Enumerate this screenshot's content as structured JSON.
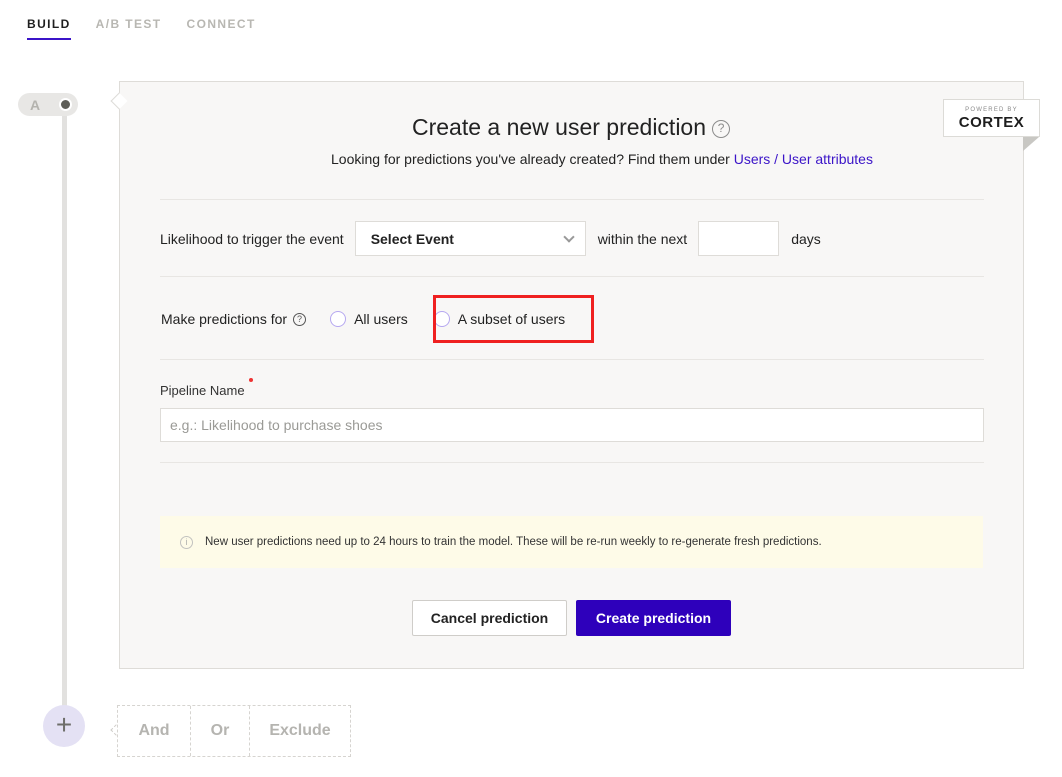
{
  "tabs": [
    {
      "label": "BUILD",
      "active": true
    },
    {
      "label": "A/B TEST",
      "active": false
    },
    {
      "label": "CONNECT",
      "active": false
    }
  ],
  "step": {
    "letter": "A"
  },
  "branding": {
    "powered_by": "POWERED BY",
    "name": "CORTEX"
  },
  "header": {
    "title": "Create a new user prediction",
    "help_glyph": "?",
    "subtitle_prefix": "Looking for predictions you've already created? Find them under ",
    "subtitle_link": "Users / User attributes"
  },
  "event_row": {
    "label": "Likelihood to trigger the event",
    "select_value": "Select Event",
    "within_label": "within the next",
    "days_value": "",
    "days_label": "days"
  },
  "prediction_row": {
    "label": "Make predictions for",
    "help_glyph": "?",
    "options": [
      {
        "label": "All users",
        "selected": false
      },
      {
        "label": "A subset of users",
        "selected": false,
        "highlighted": true
      }
    ]
  },
  "pipeline": {
    "label": "Pipeline Name",
    "required": true,
    "value": "",
    "placeholder": "e.g.: Likelihood to purchase shoes"
  },
  "notice": {
    "icon": "info-icon",
    "text": "New user predictions need up to 24 hours to train the model. These will be re-run weekly to re-generate fresh predictions."
  },
  "actions": {
    "cancel": "Cancel prediction",
    "create": "Create prediction"
  },
  "logic": {
    "add_glyph": "+",
    "options": [
      "And",
      "Or",
      "Exclude"
    ]
  },
  "colors": {
    "accent": "#2e00bb",
    "link": "#3b14c8",
    "highlight": "#ef2020",
    "notice_bg": "#fefbe8"
  }
}
